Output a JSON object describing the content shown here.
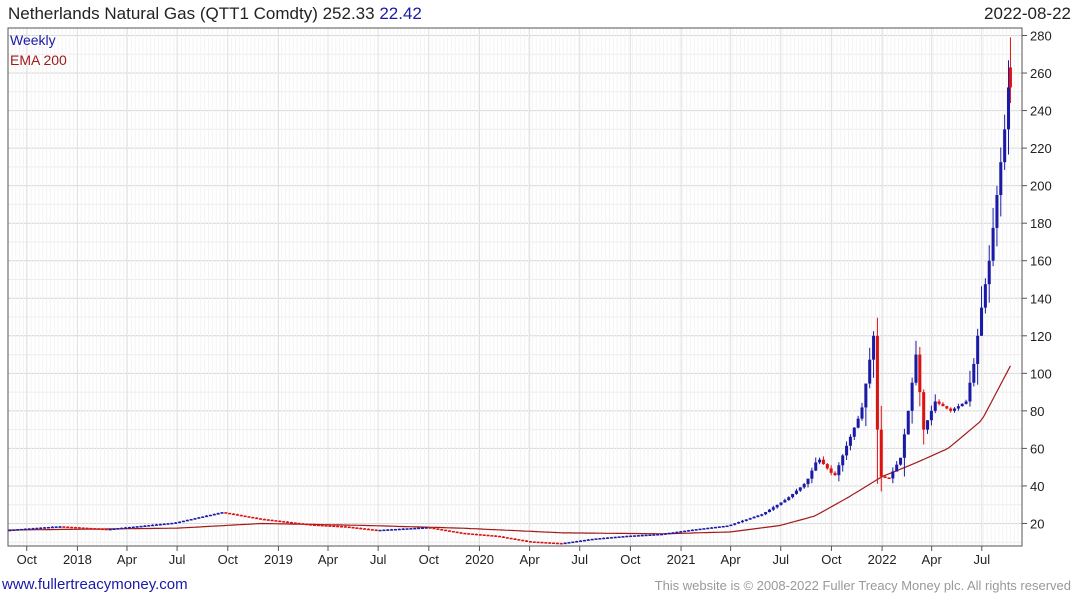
{
  "header": {
    "title": "Netherlands Natural Gas (QTT1 Comdty) 252.33",
    "change": "22.42",
    "date": "2022-08-22"
  },
  "legend": {
    "weekly": "Weekly",
    "ema": "EMA 200"
  },
  "footer": {
    "left": "www.fullertreacymoney.com",
    "right": "This website is © 2008-2022 Fuller Treacy Money plc. All rights reserved"
  },
  "colors": {
    "up": "#1a1aa6",
    "down": "#dd1111",
    "ema": "#a11a1a",
    "grid": "#e2e2e2",
    "axis": "#555555"
  },
  "chart_data": {
    "type": "line",
    "ylim": [
      8,
      284
    ],
    "y_ticks": [
      20,
      40,
      60,
      80,
      100,
      120,
      140,
      160,
      180,
      200,
      220,
      240,
      260,
      280
    ],
    "x_ticks": [
      "Oct",
      "2018",
      "Apr",
      "Jul",
      "Oct",
      "2019",
      "Apr",
      "Jul",
      "Oct",
      "2020",
      "Apr",
      "Jul",
      "Oct",
      "2021",
      "Apr",
      "Jul",
      "Oct",
      "2022",
      "Apr",
      "Jul"
    ],
    "x_tick_dates": [
      "2017-10-01",
      "2018-01-01",
      "2018-04-01",
      "2018-07-01",
      "2018-10-01",
      "2019-01-01",
      "2019-04-01",
      "2019-07-01",
      "2019-10-01",
      "2020-01-01",
      "2020-04-01",
      "2020-07-01",
      "2020-10-01",
      "2021-01-01",
      "2021-04-01",
      "2021-07-01",
      "2021-10-01",
      "2022-01-01",
      "2022-04-01",
      "2022-07-01"
    ],
    "xlim": [
      "2017-08-28",
      "2022-09-12"
    ],
    "price_key": [
      [
        "2017-08-28",
        16.5
      ],
      [
        "2017-12-01",
        18.5
      ],
      [
        "2018-03-01",
        17.0
      ],
      [
        "2018-07-01",
        20.5
      ],
      [
        "2018-09-24",
        26.0
      ],
      [
        "2018-12-01",
        22.5
      ],
      [
        "2019-03-01",
        19.5
      ],
      [
        "2019-05-01",
        18.5
      ],
      [
        "2019-07-01",
        16.5
      ],
      [
        "2019-10-01",
        18.0
      ],
      [
        "2019-12-01",
        15.0
      ],
      [
        "2020-02-01",
        13.5
      ],
      [
        "2020-04-01",
        10.5
      ],
      [
        "2020-06-01",
        9.5
      ],
      [
        "2020-08-01",
        12.0
      ],
      [
        "2020-10-01",
        13.5
      ],
      [
        "2020-12-01",
        14.5
      ],
      [
        "2021-02-01",
        17.0
      ],
      [
        "2021-04-01",
        19.0
      ],
      [
        "2021-06-01",
        25.0
      ],
      [
        "2021-07-15",
        33.0
      ],
      [
        "2021-08-20",
        42.0
      ],
      [
        "2021-09-10",
        55.0
      ],
      [
        "2021-09-25",
        50.0
      ],
      [
        "2021-10-10",
        45.0
      ],
      [
        "2021-10-30",
        60.0
      ],
      [
        "2021-11-28",
        80.0
      ],
      [
        "2021-12-20",
        120.0
      ],
      [
        "2021-12-27",
        70.0
      ],
      [
        "2022-01-03",
        45.0
      ],
      [
        "2022-01-17",
        44.0
      ],
      [
        "2022-02-07",
        55.0
      ],
      [
        "2022-02-21",
        80.0
      ],
      [
        "2022-03-07",
        110.0
      ],
      [
        "2022-03-21",
        70.0
      ],
      [
        "2022-04-11",
        85.0
      ],
      [
        "2022-05-09",
        80.0
      ],
      [
        "2022-06-06",
        85.0
      ],
      [
        "2022-06-20",
        105.0
      ],
      [
        "2022-07-04",
        135.0
      ],
      [
        "2022-07-18",
        160.0
      ],
      [
        "2022-08-01",
        195.0
      ],
      [
        "2022-08-15",
        230.0
      ],
      [
        "2022-08-22",
        252.33
      ]
    ],
    "ema_key": [
      [
        "2017-08-28",
        16.5
      ],
      [
        "2018-07-01",
        17.5
      ],
      [
        "2018-12-01",
        20.0
      ],
      [
        "2019-06-01",
        19.0
      ],
      [
        "2019-12-01",
        17.5
      ],
      [
        "2020-06-01",
        15.0
      ],
      [
        "2020-12-01",
        14.5
      ],
      [
        "2021-04-01",
        15.5
      ],
      [
        "2021-07-01",
        19.0
      ],
      [
        "2021-09-01",
        24.0
      ],
      [
        "2021-11-01",
        34.0
      ],
      [
        "2022-01-01",
        45.0
      ],
      [
        "2022-03-01",
        52.0
      ],
      [
        "2022-05-01",
        60.0
      ],
      [
        "2022-07-01",
        75.0
      ],
      [
        "2022-08-22",
        104.0
      ]
    ],
    "last_candle": {
      "date": "2022-08-22",
      "open": 263.0,
      "high": 279.0,
      "low": 244.0,
      "close": 252.33
    }
  }
}
